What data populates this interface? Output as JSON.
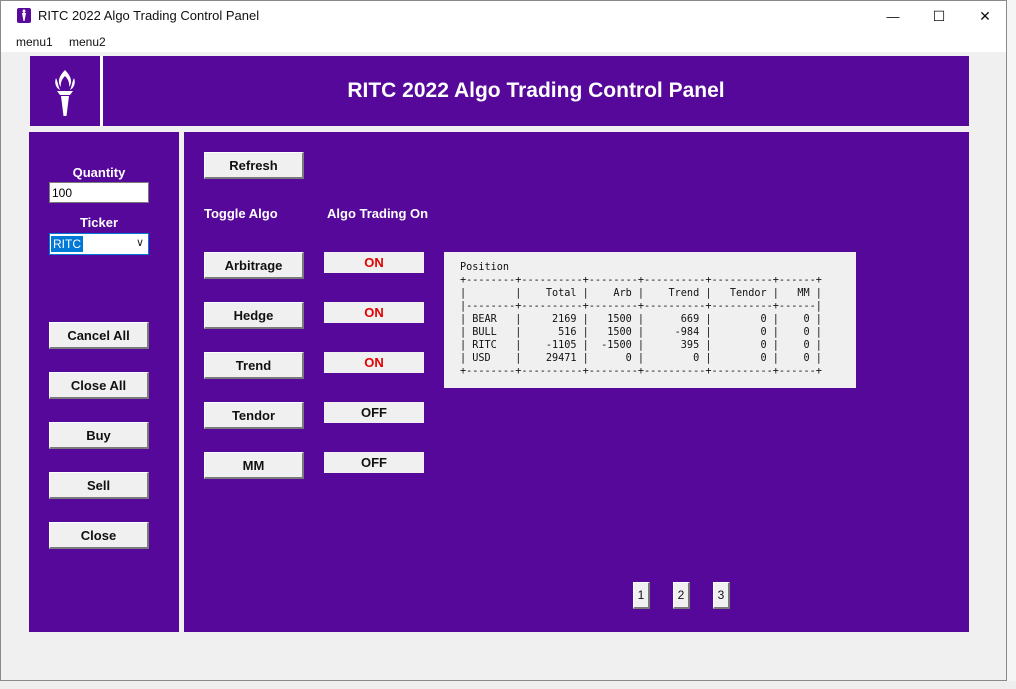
{
  "window": {
    "title": "RITC 2022 Algo Trading Control Panel",
    "minimize": "—",
    "maximize": "☐",
    "close": "✕"
  },
  "menu": [
    "menu1",
    "menu2"
  ],
  "header": {
    "title": "RITC 2022 Algo Trading Control Panel"
  },
  "left": {
    "quantity_label": "Quantity",
    "quantity_value": "100",
    "ticker_label": "Ticker",
    "ticker_value": "RITC",
    "buttons": [
      "Cancel All",
      "Close All",
      "Buy",
      "Sell",
      "Close"
    ]
  },
  "main": {
    "refresh_label": "Refresh",
    "toggle_header": "Toggle Algo",
    "status_header": "Algo Trading On",
    "algos": [
      {
        "name": "Arbitrage",
        "status": "ON"
      },
      {
        "name": "Hedge",
        "status": "ON"
      },
      {
        "name": "Trend",
        "status": "ON"
      },
      {
        "name": "Tendor",
        "status": "OFF"
      },
      {
        "name": "MM",
        "status": "OFF"
      }
    ],
    "position_table": "Position\n+--------+----------+--------+----------+----------+------+\n|        |    Total |    Arb |    Trend |   Tendor |   MM |\n|--------+----------+--------+----------+----------+------|\n| BEAR   |     2169 |   1500 |      669 |        0 |    0 |\n| BULL   |      516 |   1500 |     -984 |        0 |    0 |\n| RITC   |    -1105 |  -1500 |      395 |        0 |    0 |\n| USD    |    29471 |      0 |        0 |        0 |    0 |\n+--------+----------+--------+----------+----------+------+",
    "pages": [
      "1",
      "2",
      "3"
    ]
  },
  "colors": {
    "purple": "#55089a",
    "on": "#e00000",
    "off": "#111111"
  }
}
